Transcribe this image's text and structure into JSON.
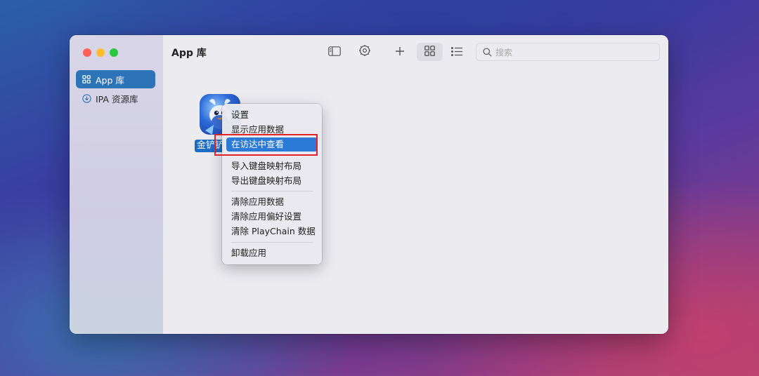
{
  "sidebar": {
    "items": [
      {
        "label": "App 库",
        "icon": "grid-icon",
        "active": true
      },
      {
        "label": "IPA 资源库",
        "icon": "download-circle-icon",
        "active": false
      }
    ]
  },
  "header": {
    "title": "App 库",
    "search_placeholder": "搜索",
    "toolbar_icons": [
      "sidebar-toggle-icon",
      "gear-icon",
      "plus-icon",
      "grid-view-icon",
      "list-view-icon"
    ]
  },
  "app": {
    "label": "金铲铲之战"
  },
  "context_menu": {
    "items": [
      "设置",
      "显示应用数据",
      "在访达中查看",
      "导入键盘映射布局",
      "导出键盘映射布局",
      "清除应用数据",
      "清除应用偏好设置",
      "清除 PlayChain 数据",
      "卸载应用"
    ],
    "highlighted": "在访达中查看"
  },
  "colors": {
    "accent": "#2c73b8",
    "menu_highlight": "#2b7ad6",
    "annotation_box": "#e1212c"
  }
}
